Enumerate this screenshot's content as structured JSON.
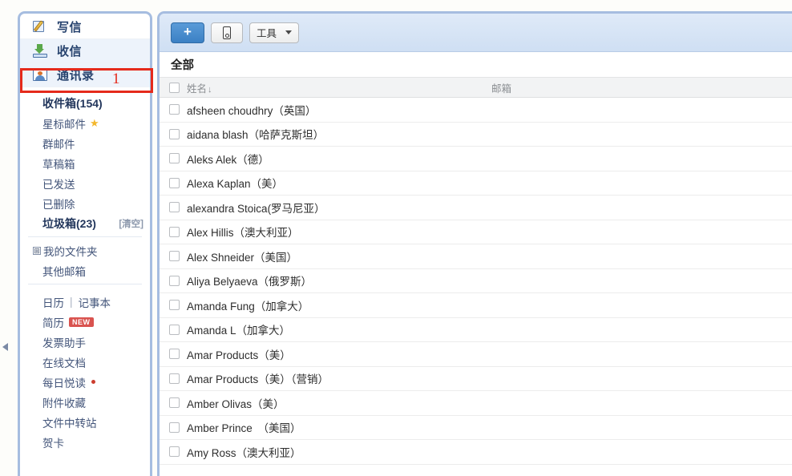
{
  "sidebar": {
    "nav": [
      {
        "label": "写信",
        "icon": "write-icon"
      },
      {
        "label": "收信",
        "icon": "receive-icon"
      },
      {
        "label": "通讯录",
        "icon": "contacts-icon"
      }
    ],
    "annotation": {
      "number": "1"
    },
    "folders": [
      {
        "label": "收件箱(154)",
        "bold": true
      },
      {
        "label": "星标邮件",
        "star": "★"
      },
      {
        "label": "群邮件"
      },
      {
        "label": "草稿箱"
      },
      {
        "label": "已发送"
      },
      {
        "label": "已删除"
      },
      {
        "label": "垃圾箱(23)",
        "bold": true,
        "action": "[清空]"
      }
    ],
    "my_folder": {
      "expander": "⊞",
      "label": "我的文件夹"
    },
    "other_mailbox": {
      "label": "其他邮箱"
    },
    "tools": [
      {
        "label": "日历",
        "sep": "|",
        "label2": "记事本"
      },
      {
        "label": "简历",
        "badge": "NEW"
      },
      {
        "label": "发票助手"
      },
      {
        "label": "在线文档"
      },
      {
        "label": "每日悦读",
        "dot": true
      },
      {
        "label": "附件收藏"
      },
      {
        "label": "文件中转站"
      },
      {
        "label": "贺卡"
      }
    ]
  },
  "toolbar": {
    "add_label": "+",
    "mobile_icon": "mobile-phone-icon",
    "tools_label": "工具"
  },
  "main": {
    "section_title": "全部",
    "columns": {
      "name": "姓名",
      "sort": "↓",
      "mail": "邮箱"
    },
    "contacts": [
      {
        "name": "afsheen choudhry（英国）",
        "mail": ""
      },
      {
        "name": "aidana blash（哈萨克斯坦）",
        "mail": ""
      },
      {
        "name": "Aleks Alek（德）",
        "mail": ""
      },
      {
        "name": " Alexa Kaplan（美）",
        "mail": ""
      },
      {
        "name": "alexandra Stoica(罗马尼亚）",
        "mail": ""
      },
      {
        "name": "Alex Hillis（澳大利亚）",
        "mail": ""
      },
      {
        "name": "Alex Shneider（美国）",
        "mail": ""
      },
      {
        "name": "Aliya Belyaeva（俄罗斯）",
        "mail": ""
      },
      {
        "name": "Amanda Fung（加拿大）",
        "mail": ""
      },
      {
        "name": "Amanda L（加拿大）",
        "mail": ""
      },
      {
        "name": "Amar Products（美）",
        "mail": ""
      },
      {
        "name": "Amar Products（美）（营销）",
        "mail": ""
      },
      {
        "name": " Amber Olivas（美）",
        "mail": ""
      },
      {
        "name": "Amber Prince　（美国）",
        "mail": ""
      },
      {
        "name": "Amy Ross（澳大利亚）",
        "mail": ""
      }
    ]
  },
  "colors": {
    "panel_border": "#a6bde0",
    "toolbar_blue": "#cfdff3",
    "accent_button": "#3b80c4",
    "annotation_red": "#e52a1b",
    "badge_red": "#d9534f"
  }
}
